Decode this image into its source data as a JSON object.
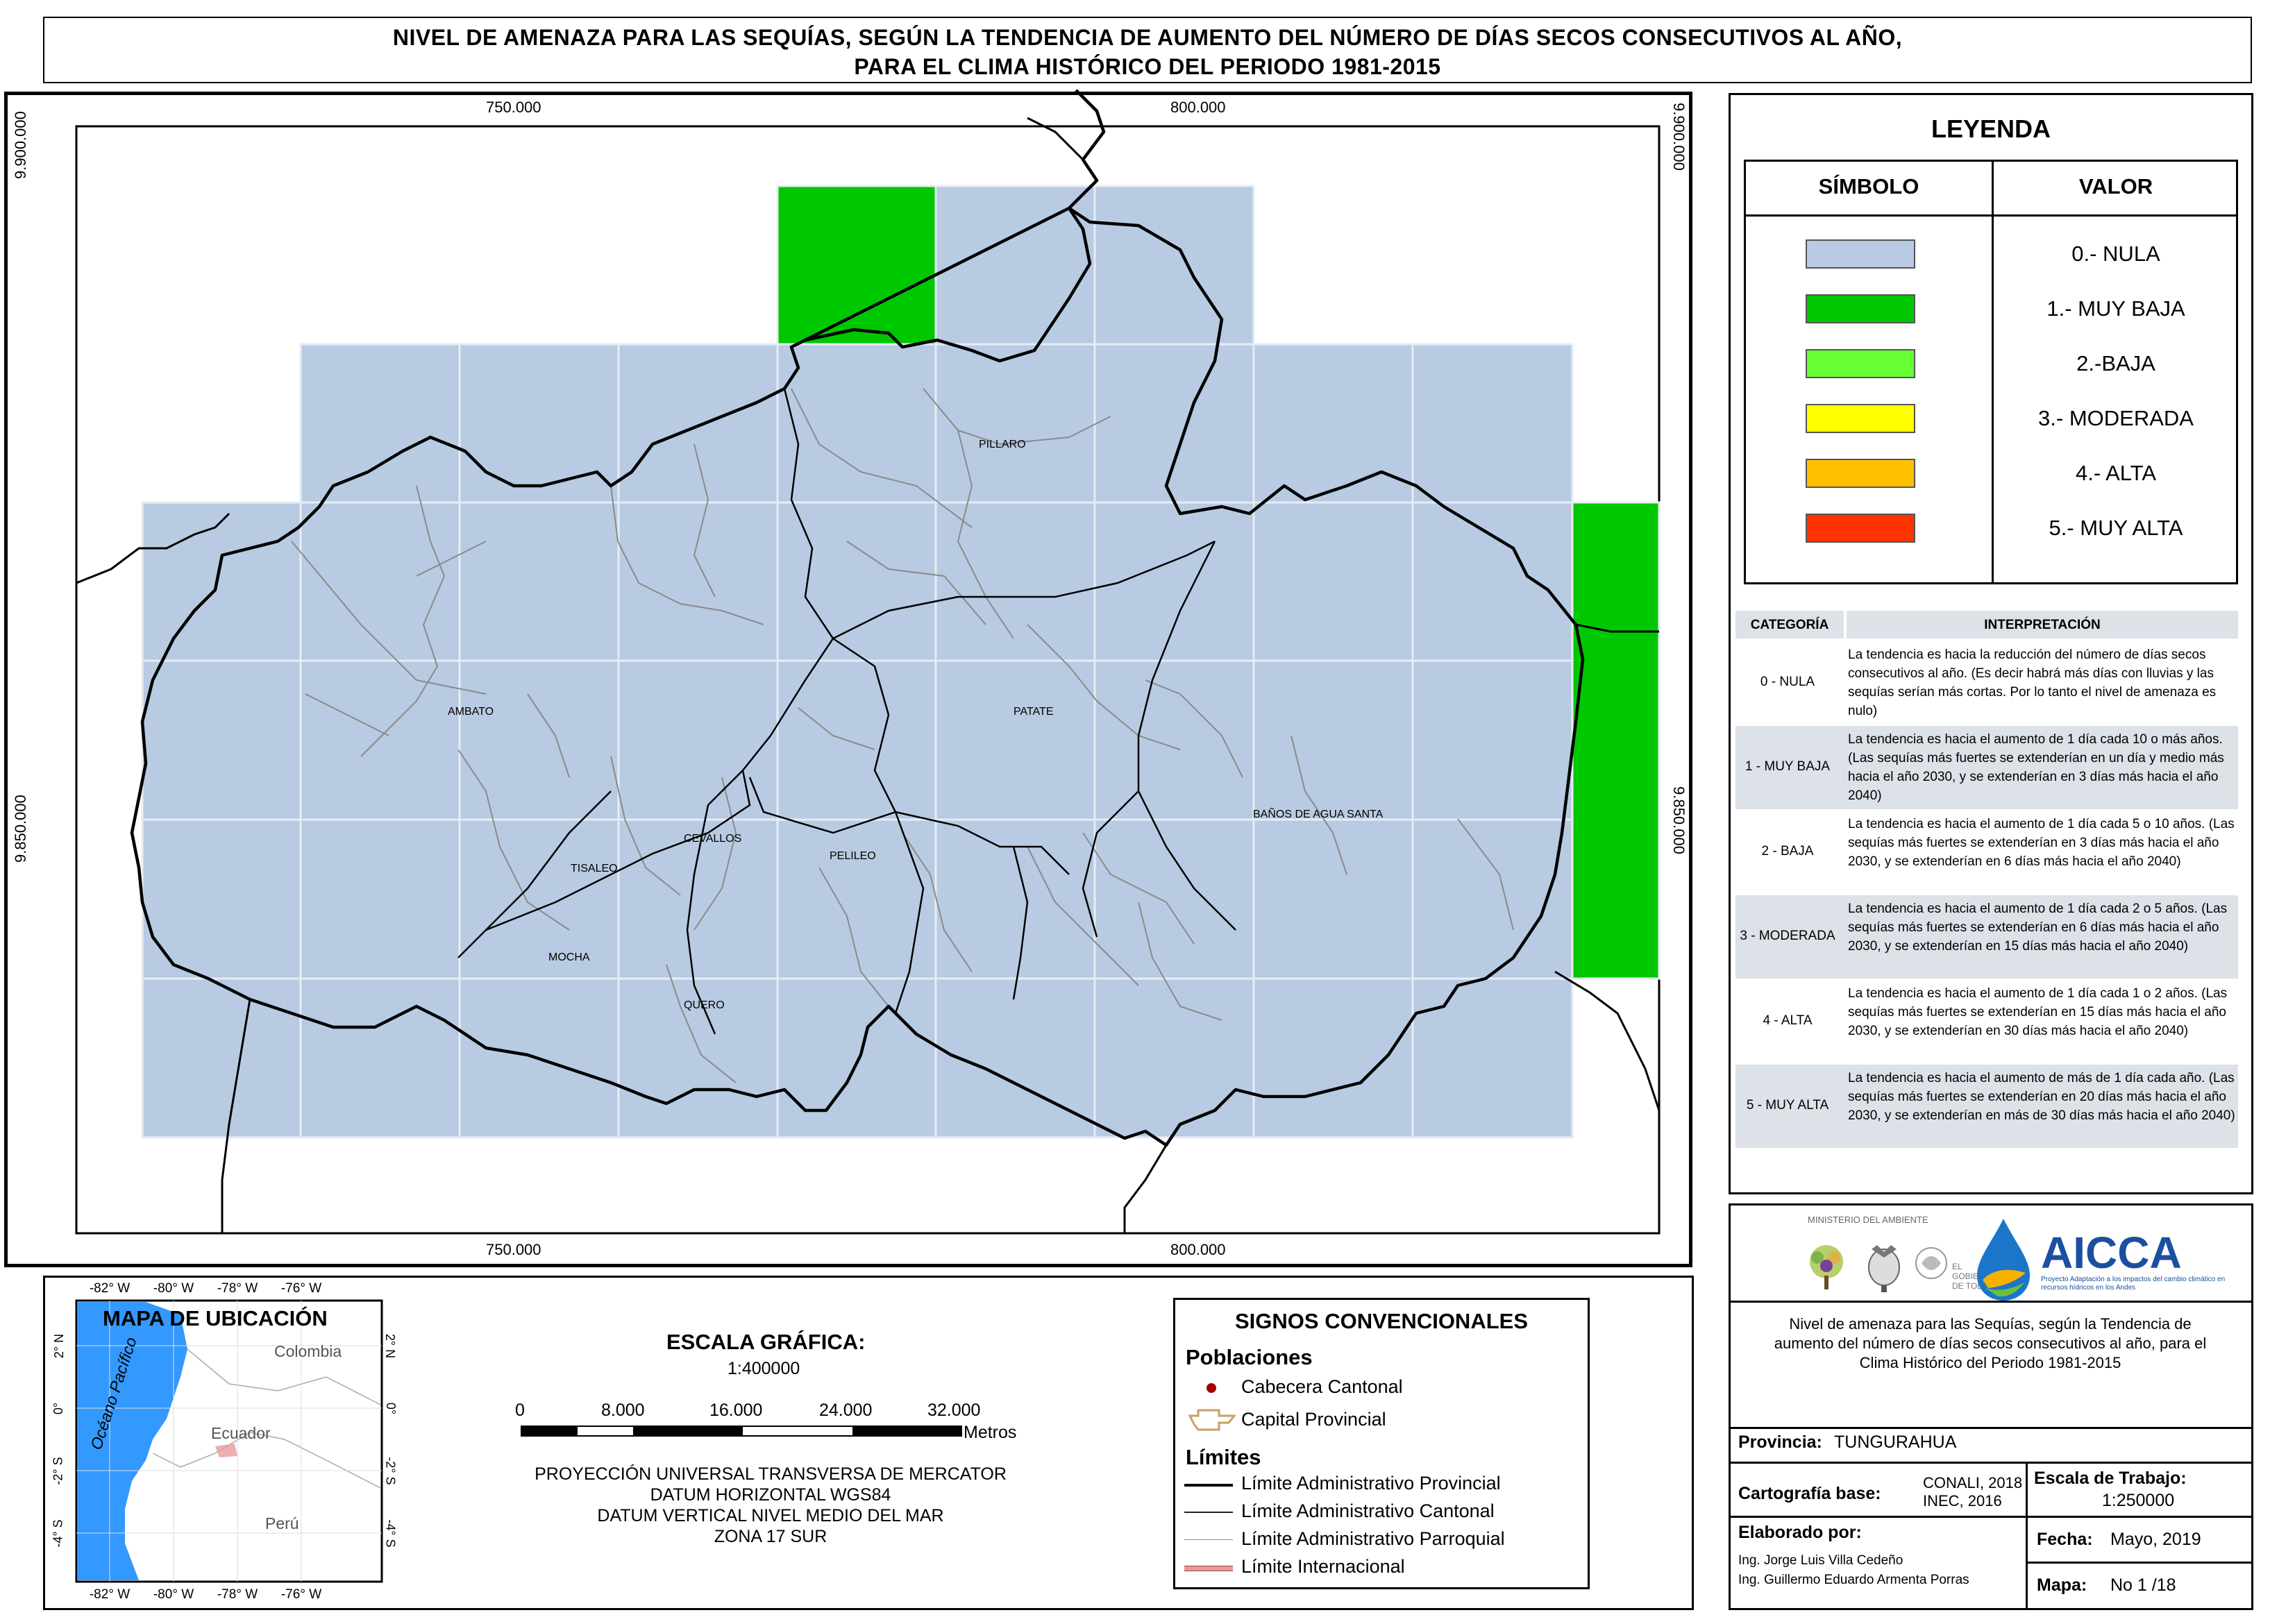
{
  "title": {
    "line1": "NIVEL DE AMENAZA PARA LAS SEQUÍAS, SEGÚN LA TENDENCIA DE AUMENTO DEL NÚMERO DE DÍAS SECOS CONSECUTIVOS AL AÑO,",
    "line2": "PARA EL CLIMA HISTÓRICO DEL PERIODO 1981-2015"
  },
  "grid": {
    "x_labels": [
      "750.000",
      "800.000"
    ],
    "y_labels": [
      "9.900.000",
      "9.850.000"
    ]
  },
  "places": [
    "PILLARO",
    "AMBATO",
    "PATATE",
    "BAÑOS DE AGUA SANTA",
    "TISALEO",
    "CEVALLOS",
    "PELILEO",
    "MOCHA",
    "QUERO"
  ],
  "colors": {
    "nula": "#b9cbe2",
    "muy_baja": "#00c800",
    "baja": "#66ff33",
    "moderada": "#ffff00",
    "alta": "#ffc000",
    "muy_alta": "#ff3300"
  },
  "legend": {
    "title": "LEYENDA",
    "col_symbol": "SÍMBOLO",
    "col_value": "VALOR",
    "items": [
      {
        "label": "0.- NULA",
        "color": "#b9cbe2"
      },
      {
        "label": "1.- MUY BAJA",
        "color": "#00c800"
      },
      {
        "label": "2.-BAJA",
        "color": "#66ff33"
      },
      {
        "label": "3.- MODERADA",
        "color": "#ffff00"
      },
      {
        "label": "4.- ALTA",
        "color": "#ffc000"
      },
      {
        "label": "5.- MUY ALTA",
        "color": "#ff3300"
      }
    ]
  },
  "interpretation": {
    "col_category": "CATEGORÍA",
    "col_interpretation": "INTERPRETACIÓN",
    "rows": [
      {
        "cat": "0 - NULA",
        "text": "La tendencia es hacia la reducción del número de días secos consecutivos al año. (Es decir habrá más días con lluvias y las sequías serían más cortas. Por lo tanto el nivel de amenaza es nulo)"
      },
      {
        "cat": "1 - MUY BAJA",
        "text": "La tendencia es hacia el aumento de 1 día cada 10 o más años. (Las sequías más fuertes se extenderían en un día y medio más hacia el año 2030, y se extenderían en 3 días más hacia el año 2040)"
      },
      {
        "cat": "2 - BAJA",
        "text": "La tendencia es hacia el aumento de 1 día cada 5 o 10 años. (Las sequías más fuertes se extenderían en 3 días más hacia el año 2030, y se extenderían en 6 días más hacia el año 2040)"
      },
      {
        "cat": "3 - MODERADA",
        "text": "La tendencia es hacia el aumento de 1 día cada 2 o 5 años. (Las sequías más fuertes se extenderían en 6 días más hacia el año 2030, y se extenderían en 15 días más hacia el año 2040)"
      },
      {
        "cat": "4 - ALTA",
        "text": "La tendencia es hacia el aumento de 1 día cada 1 o 2 años. (Las sequías más fuertes se extenderían en 15 días más hacia el año 2030, y se extenderían en 30 días más hacia el año 2040)"
      },
      {
        "cat": "5 - MUY ALTA",
        "text": "La tendencia es hacia el aumento de más de 1 día cada año. (Las sequías más fuertes se extenderían en 20 días más hacia el año 2030, y se extenderían en más de 30 días más hacia el año 2040)"
      }
    ]
  },
  "location_map": {
    "title": "MAPA DE UBICACIÓN",
    "lon_labels": [
      "-82° W",
      "-80° W",
      "-78° W",
      "-76° W"
    ],
    "lat_labels": [
      "2° N",
      "0°",
      "-2° S",
      "-4° S"
    ],
    "ocean": "Océano Pacífico",
    "countries": [
      "Colombia",
      "Ecuador",
      "Perú"
    ]
  },
  "scale": {
    "title": "ESCALA GRÁFICA:",
    "ratio": "1:400000",
    "ticks": [
      "0",
      "8.000",
      "16.000",
      "24.000",
      "32.000"
    ],
    "unit": "Metros",
    "projection": [
      "PROYECCIÓN UNIVERSAL TRANSVERSA DE MERCATOR",
      "DATUM HORIZONTAL WGS84",
      "DATUM VERTICAL NIVEL MEDIO DEL MAR",
      "ZONA 17 SUR"
    ]
  },
  "signs": {
    "title": "SIGNOS CONVENCIONALES",
    "poblaciones": "Poblaciones",
    "cabecera": "Cabecera Cantonal",
    "capital": "Capital Provincial",
    "limites": "Límites",
    "lim_provincial": "Límite Administrativo Provincial",
    "lim_cantonal": "Límite Administrativo Cantonal",
    "lim_parroquial": "Límite Administrativo Parroquial",
    "lim_internacional": "Límite Internacional"
  },
  "logos": {
    "ministerio": "MINISTERIO DEL AMBIENTE",
    "gobierno_line1": "EL",
    "gobierno_line2": "GOBIERNO",
    "gobierno_line3": "DE TODOS",
    "aicca": "AICCA",
    "aicca_sub": "Proyecto Adaptación a los impactos del cambio climático en recursos hídricos en los Andes"
  },
  "info": {
    "description": "Nivel de amenaza para las Sequías, según la Tendencia de aumento del número de días secos consecutivos al año, para el Clima Histórico del Periodo 1981-2015",
    "provincia_label": "Provincia:",
    "provincia_value": "TUNGURAHUA",
    "cartografia_label": "Cartografía base:",
    "cartografia_value1": "CONALI, 2018",
    "cartografia_value2": "INEC, 2016",
    "escala_label": "Escala de Trabajo:",
    "escala_value": "1:250000",
    "elaborado_label": "Elaborado por:",
    "autor1": "Ing. Jorge Luis Villa Cedeño",
    "autor2": "Ing. Guillermo Eduardo Armenta Porras",
    "fecha_label": "Fecha:",
    "fecha_value": "Mayo, 2019",
    "mapa_label": "Mapa:",
    "mapa_value": "No 1 /18"
  }
}
